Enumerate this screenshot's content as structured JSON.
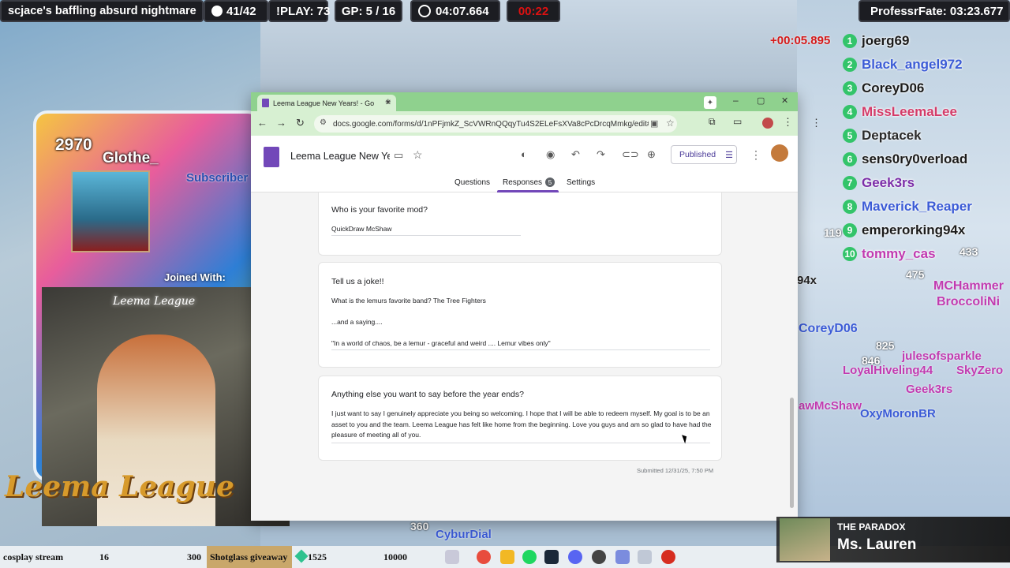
{
  "stream": {
    "title": "scjace's baffling absurd nightmare",
    "counter": "41/42",
    "play": "!PLAY: 73",
    "gp": "GP: 5 / 16",
    "timer": "04:07.664",
    "red_timer": "00:22",
    "pb": "ProfessrFate: 03:23.677",
    "delta": "+00:05.895"
  },
  "leaderboard": [
    {
      "rank": "1",
      "name": "joerg69",
      "color": "#1b1b1b"
    },
    {
      "rank": "2",
      "name": "Black_angel972",
      "color": "#3b5bd6"
    },
    {
      "rank": "3",
      "name": "CoreyD06",
      "color": "#1b1b1b"
    },
    {
      "rank": "4",
      "name": "MissLeemaLee",
      "color": "#d43b68"
    },
    {
      "rank": "5",
      "name": "Deptacek",
      "color": "#2a2a2a"
    },
    {
      "rank": "6",
      "name": "sens0ry0verload",
      "color": "#1b1b1b"
    },
    {
      "rank": "7",
      "name": "Geek3rs",
      "color": "#7b2da8"
    },
    {
      "rank": "8",
      "name": "Maverick_Reaper",
      "color": "#3b5bd6"
    },
    {
      "rank": "9",
      "name": "emperorking94x",
      "color": "#1b1b1b"
    },
    {
      "rank": "10",
      "name": "tommy_cas",
      "color": "#c13ab0"
    }
  ],
  "subscriber": {
    "count": "2970",
    "name": "Glothe_",
    "label": "Subscriber",
    "joined": "Joined With:"
  },
  "overlay_names": {
    "n1": "MCHammer",
    "n2": "BroccoliNi",
    "n3": "CoreyD06",
    "n4": "julesofsparkle",
    "n5": "LoyalHiveling44",
    "n6": "SkyZero",
    "n7": "Geek3rs",
    "n8": "OxyMoronBR",
    "n9": "awMcShaw",
    "n10": "CyburDial",
    "s1": "119",
    "s2": "433",
    "s3": "475",
    "s4": "825",
    "s5": "846",
    "s6": "360",
    "s7": "94x"
  },
  "browser": {
    "tab_title": "Leema League New Years! - Go",
    "url": "docs.google.com/forms/d/1nPFjmkZ_ScVWRnQQqyTu4S2ELeFsXVa8cPcDrcqMmkg/edit#respons...",
    "doc_title": "Leema League New Yea",
    "published": "Published",
    "tabs": {
      "questions": "Questions",
      "responses": "Responses",
      "responses_count": "5",
      "settings": "Settings"
    }
  },
  "form": {
    "q1": "Who is your favorite mod?",
    "a1": "QuickDraw McShaw",
    "q2": "Tell us a joke!!",
    "a2_line1": "What is the lemurs favorite band?  The Tree Fighters",
    "a2_line2": "...and a saying....",
    "a2_line3": "\"In a world of chaos, be a lemur - graceful and weird .... Lemur vibes only\"",
    "q3": "Anything else you want to say before the year ends?",
    "a3": "I just want to say I genuinely appreciate you being so welcoming. I hope that I will be able to redeem myself. My goal is to be an asset to you and the team. Leema League has felt like home from the beginning. Love you guys and am so glad to have had the pleasure of meeting all of you.",
    "submitted": "Submitted 12/31/25, 7:50 PM"
  },
  "bottom": {
    "seg1": "cosplay stream",
    "seg1_val": "16",
    "seg2_val": "300",
    "seg3": "Shotglass giveaway",
    "seg3_val": "1525",
    "seg4_val": "10000",
    "paradox_title": "THE PARADOX",
    "paradox_name": "Ms. Lauren",
    "watermark": "Leema League"
  }
}
